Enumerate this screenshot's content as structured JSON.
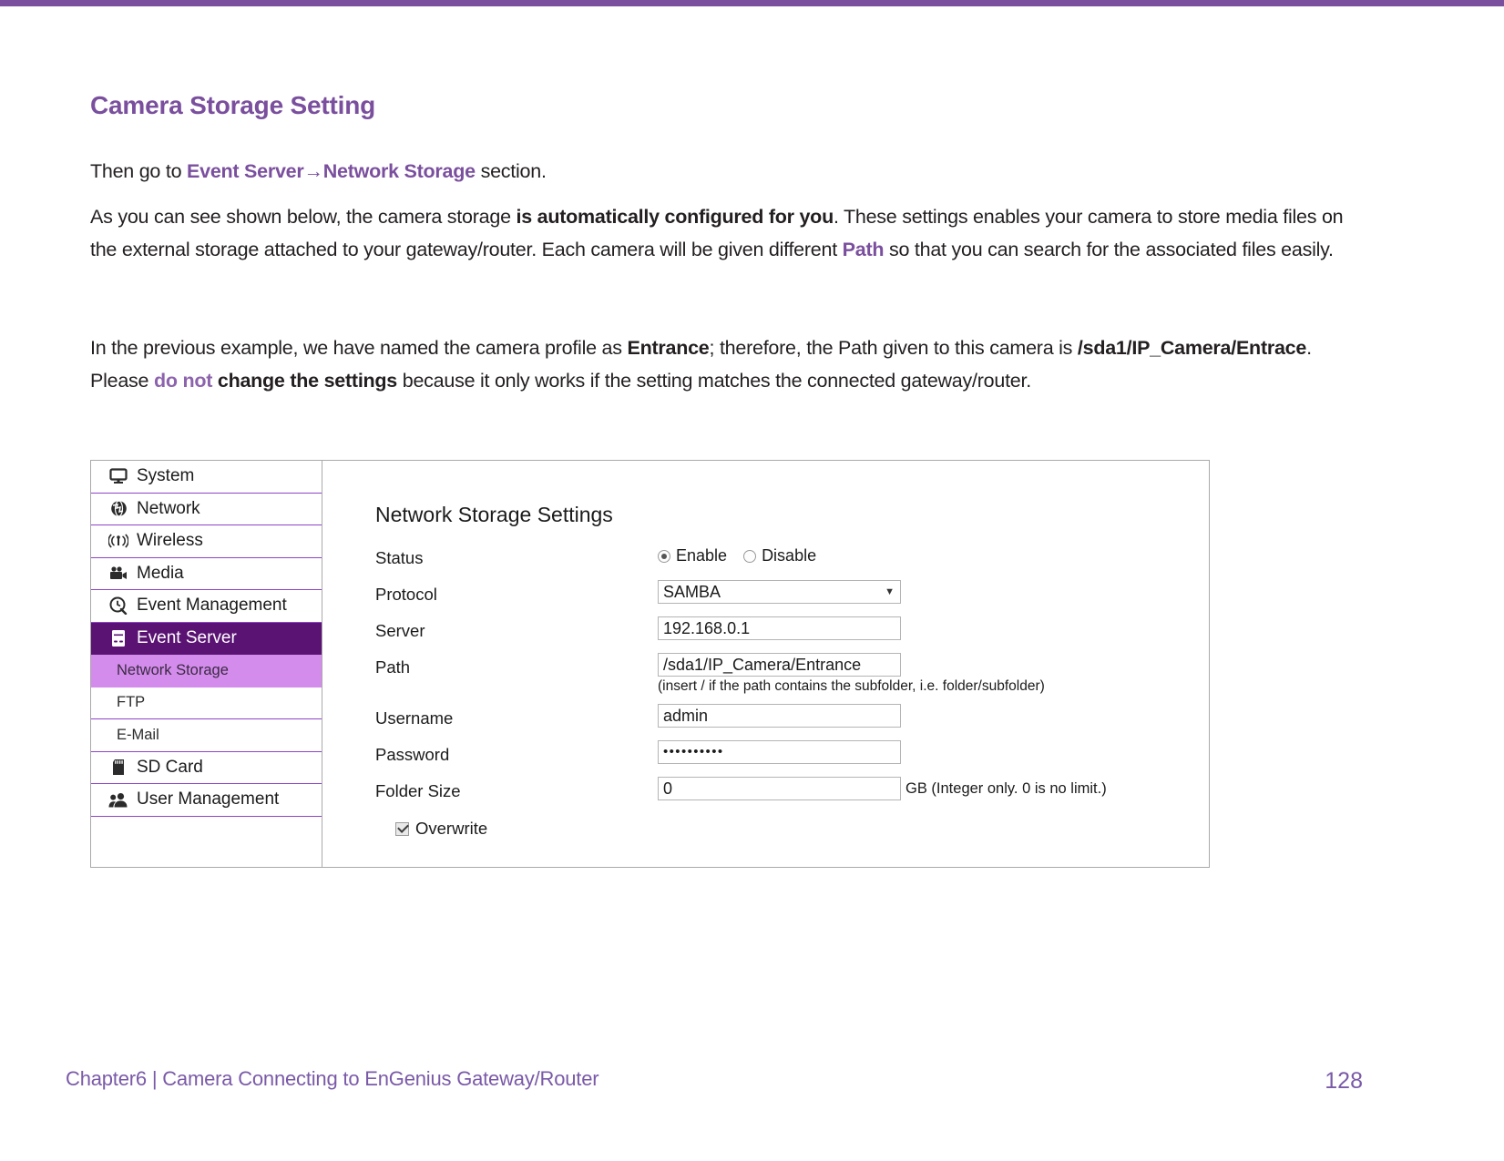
{
  "doc": {
    "section_title": "Camera Storage Setting",
    "para1": {
      "pre": "Then go to ",
      "link1": "Event Server",
      "arrow": "→",
      "link2": "Network Storage",
      "post": " section."
    },
    "para2": {
      "t1": "As you can see shown below, the camera storage ",
      "b1": "is automatically configured for you",
      "t2": ". These settings enables your camera to store media files on the external storage attached to your gateway/router. Each camera will be given different ",
      "p1": "Path",
      "t3": " so that you can search for the associated files easily."
    },
    "para3": {
      "t1": "In the previous example, we have named the camera profile as ",
      "b1": "Entrance",
      "t2": "; therefore, the Path given to this camera is ",
      "b2": "/sda1/IP_Camera/Entrace",
      "t3": ". Please ",
      "p1": "do not",
      "b3": " change the settings",
      "t4": " because it only works if the setting matches the connected gateway/router."
    }
  },
  "footer": {
    "text": "Chapter6  |  Camera Connecting to EnGenius Gateway/Router",
    "page": "128"
  },
  "screenshot": {
    "menu": [
      {
        "label": "System",
        "icon": "monitor-icon",
        "type": "top"
      },
      {
        "label": "Network",
        "icon": "globe-icon",
        "type": "top"
      },
      {
        "label": "Wireless",
        "icon": "wireless-signal-icon",
        "type": "top"
      },
      {
        "label": "Media",
        "icon": "video-camera-icon",
        "type": "top"
      },
      {
        "label": "Event Management",
        "icon": "clock-search-icon",
        "type": "top"
      },
      {
        "label": "Event Server",
        "icon": "server-icon",
        "type": "active"
      },
      {
        "label": "Network Storage",
        "icon": "none",
        "type": "sub-selected"
      },
      {
        "label": "FTP",
        "icon": "none",
        "type": "sub"
      },
      {
        "label": "E-Mail",
        "icon": "none",
        "type": "sub"
      },
      {
        "label": "SD Card",
        "icon": "sd-card-icon",
        "type": "top"
      },
      {
        "label": "User Management",
        "icon": "users-icon",
        "type": "top"
      }
    ],
    "panel": {
      "title": "Network Storage Settings",
      "fields": {
        "status_label": "Status",
        "status_enable": "Enable",
        "status_disable": "Disable",
        "status_value": "Enable",
        "protocol_label": "Protocol",
        "protocol_value": "SAMBA",
        "protocol_caret": "▼",
        "server_label": "Server",
        "server_value": "192.168.0.1",
        "path_label": "Path",
        "path_value": "/sda1/IP_Camera/Entrance",
        "path_hint": "(insert / if the path contains the subfolder, i.e. folder/subfolder)",
        "username_label": "Username",
        "username_value": "admin",
        "password_label": "Password",
        "password_value": "••••••••••",
        "folder_size_label": "Folder Size",
        "folder_size_value": "0",
        "folder_size_hint": "GB (Integer only. 0 is no limit.)",
        "overwrite_label": "Overwrite",
        "overwrite_checked": "checked"
      }
    }
  },
  "colors": {
    "accent": "#7a4f9e",
    "menu_active": "#5a1373",
    "menu_sub_selected": "#d48cec",
    "top_bar": "#7a4f9e"
  }
}
